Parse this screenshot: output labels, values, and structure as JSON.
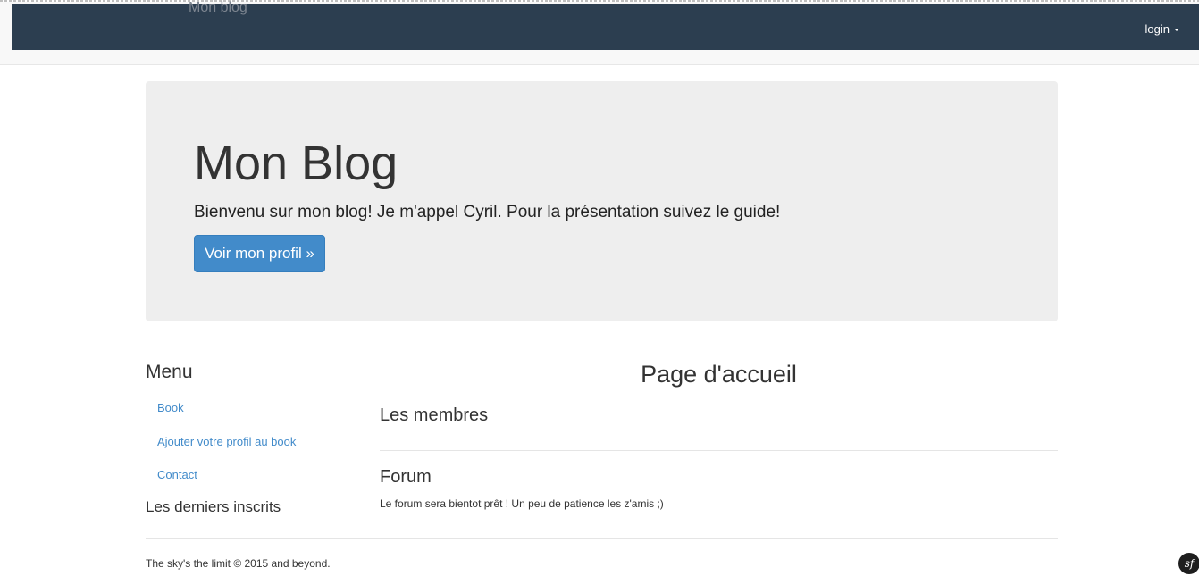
{
  "navbar": {
    "brand": "Mon blog",
    "login_label": "login"
  },
  "jumbotron": {
    "title": "Mon Blog",
    "text": "Bienvenu sur mon blog! Je m'appel Cyril. Pour la présentation suivez le guide!",
    "button_label": "Voir mon profil »"
  },
  "sidebar": {
    "title": "Menu",
    "links": [
      {
        "label": "Book"
      },
      {
        "label": "Ajouter votre profil au book"
      },
      {
        "label": "Contact"
      }
    ],
    "latest_title": "Les derniers inscrits"
  },
  "main": {
    "page_title": "Page d'accueil",
    "members_title": "Les membres",
    "forum_title": "Forum",
    "forum_text": "Le forum sera bientot prêt ! Un peu de patience les z'amis ;)"
  },
  "footer": {
    "text": "The sky's the limit © 2015 and beyond."
  },
  "debug_toolbar": {
    "label": "sf"
  },
  "colors": {
    "navbar_bg": "#2c3e50",
    "jumbotron_bg": "#eeeeee",
    "primary": "#428bca",
    "link": "#428bca"
  }
}
